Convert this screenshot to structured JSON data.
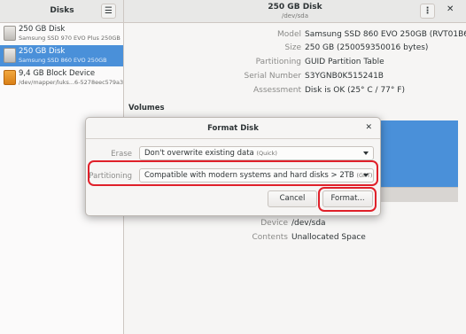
{
  "sidebar": {
    "title": "Disks",
    "drives": [
      {
        "name": "250 GB Disk",
        "desc": "Samsung SSD 970 EVO Plus 250GB",
        "icon": "drive-icon"
      },
      {
        "name": "250 GB Disk",
        "desc": "Samsung SSD 860 EVO 250GB",
        "icon": "drive-icon",
        "selected": true
      },
      {
        "name": "9,4 GB Block Device",
        "desc": "/dev/mapper/luks...6-5278eec579a3",
        "icon": "block-device-icon"
      }
    ]
  },
  "header": {
    "title": "250 GB Disk",
    "subtitle": "/dev/sda",
    "menu_icon": "kebab-menu-icon",
    "close_icon": "close-icon"
  },
  "disk_info": [
    {
      "label": "Model",
      "value": "Samsung SSD 860 EVO 250GB (RVT01B6Q)"
    },
    {
      "label": "Size",
      "value": "250 GB (250059350016 bytes)"
    },
    {
      "label": "Partitioning",
      "value": "GUID Partition Table"
    },
    {
      "label": "Serial Number",
      "value": "S3YGNB0K515241B"
    },
    {
      "label": "Assessment",
      "value": "Disk is OK (25° C / 77° F)"
    }
  ],
  "volumes_heading": "Volumes",
  "volume_details": [
    {
      "label": "Device",
      "value": "/dev/sda"
    },
    {
      "label": "Contents",
      "value": "Unallocated Space"
    }
  ],
  "dialog": {
    "title": "Format Disk",
    "erase": {
      "label": "Erase",
      "value": "Don't overwrite existing data",
      "hint": "(Quick)"
    },
    "partitioning": {
      "label": "Partitioning",
      "value": "Compatible with modern systems and hard disks > 2TB",
      "hint": "(GPT)"
    },
    "cancel_label": "Cancel",
    "format_label": "Format..."
  },
  "colors": {
    "accent": "#4a90d9",
    "highlight": "#e0202a"
  }
}
